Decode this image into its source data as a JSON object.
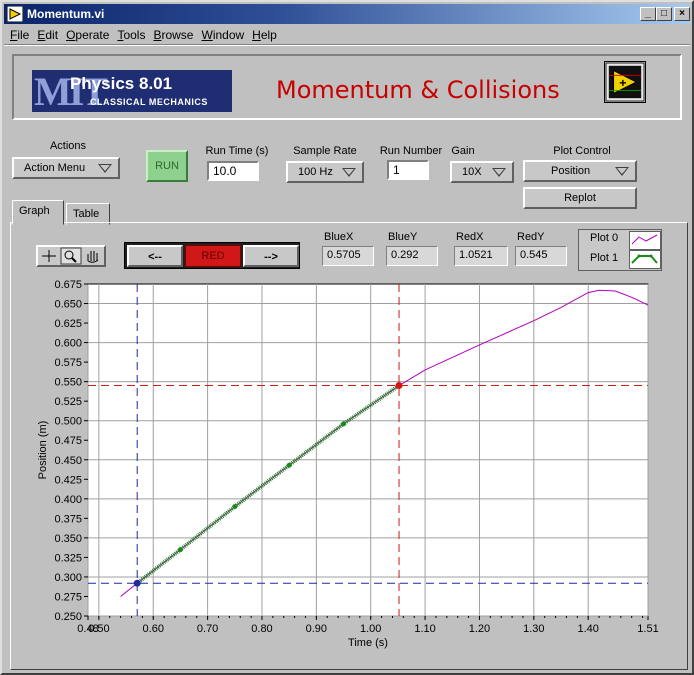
{
  "window": {
    "title": "Momentum.vi",
    "min_label": "_",
    "max_label": "□",
    "close_label": "×"
  },
  "menu": [
    "File",
    "Edit",
    "Operate",
    "Tools",
    "Browse",
    "Window",
    "Help"
  ],
  "menu_underline": [
    "F",
    "E",
    "O",
    "T",
    "B",
    "W",
    "H"
  ],
  "header": {
    "logo_mit": "MIT",
    "logo_course": "Physics 8.01",
    "logo_subtitle": "CLASSICAL MECHANICS",
    "title": "Momentum & Collisions",
    "title_color": "#c80000"
  },
  "controls": {
    "actions": {
      "label": "Actions",
      "value": "Action Menu"
    },
    "run_button": "RUN",
    "run_time": {
      "label": "Run Time (s)",
      "value": "10.0"
    },
    "sample_rate": {
      "label": "Sample Rate",
      "value": "100 Hz"
    },
    "run_number": {
      "label": "Run Number",
      "value": "1"
    },
    "gain": {
      "label": "Gain",
      "value": "10X"
    },
    "plot_control": {
      "label": "Plot Control",
      "value": "Position"
    },
    "replot_button": "Replot"
  },
  "tabs": [
    {
      "label": "Graph",
      "active": true
    },
    {
      "label": "Table",
      "active": false
    }
  ],
  "cursor_nav": {
    "left": "<--",
    "cursor": "RED",
    "right": "-->",
    "cursor_color": "#d01818"
  },
  "readouts": {
    "blue_x": {
      "label": "BlueX",
      "value": "0.5705"
    },
    "blue_y": {
      "label": "BlueY",
      "value": "0.292"
    },
    "red_x": {
      "label": "RedX",
      "value": "1.0521"
    },
    "red_y": {
      "label": "RedY",
      "value": "0.545"
    }
  },
  "legend": [
    {
      "label": "Plot 0",
      "color": "#b000c0"
    },
    {
      "label": "Plot 1",
      "color": "#1a8a1a"
    }
  ],
  "chart_data": {
    "type": "line",
    "xlabel": "Time (s)",
    "ylabel": "Position (m)",
    "xlim": [
      0.48,
      1.51
    ],
    "ylim": [
      0.25,
      0.675
    ],
    "xticks": [
      0.48,
      0.5,
      0.6,
      0.7,
      0.8,
      0.9,
      1.0,
      1.1,
      1.2,
      1.3,
      1.4,
      1.51
    ],
    "xtick_labels": [
      "0.48",
      "0.50",
      "0.60",
      "0.70",
      "0.80",
      "0.90",
      "1.00",
      "1.10",
      "1.20",
      "1.30",
      "1.40",
      "1.51"
    ],
    "yticks": [
      0.25,
      0.275,
      0.3,
      0.325,
      0.35,
      0.375,
      0.4,
      0.425,
      0.45,
      0.475,
      0.5,
      0.525,
      0.55,
      0.575,
      0.6,
      0.625,
      0.65,
      0.675
    ],
    "ytick_labels": [
      "0.250",
      "0.275",
      "0.300",
      "0.325",
      "0.350",
      "0.375",
      "0.400",
      "0.425",
      "0.450",
      "0.475",
      "0.500",
      "0.525",
      "0.550",
      "0.575",
      "0.600",
      "0.625",
      "0.650",
      "0.675"
    ],
    "grid": true,
    "background": "#ffffff",
    "series": [
      {
        "name": "Plot 0",
        "color": "#b000c0",
        "x": [
          0.54,
          0.5705,
          0.65,
          0.75,
          0.85,
          0.95,
          1.0521,
          1.1,
          1.2,
          1.3,
          1.35,
          1.4,
          1.42,
          1.45,
          1.48,
          1.51
        ],
        "y": [
          0.275,
          0.292,
          0.335,
          0.39,
          0.443,
          0.496,
          0.545,
          0.565,
          0.597,
          0.628,
          0.645,
          0.664,
          0.667,
          0.666,
          0.658,
          0.648
        ]
      },
      {
        "name": "Plot 1",
        "color": "#1a8a1a",
        "x": [
          0.5705,
          0.65,
          0.75,
          0.85,
          0.95,
          1.0521
        ],
        "y": [
          0.292,
          0.335,
          0.39,
          0.443,
          0.496,
          0.545
        ]
      }
    ],
    "cursors": [
      {
        "name": "blue",
        "color": "#1c2a9c",
        "x": 0.5705,
        "y": 0.292
      },
      {
        "name": "red",
        "color": "#d01818",
        "x": 1.0521,
        "y": 0.545
      }
    ]
  }
}
